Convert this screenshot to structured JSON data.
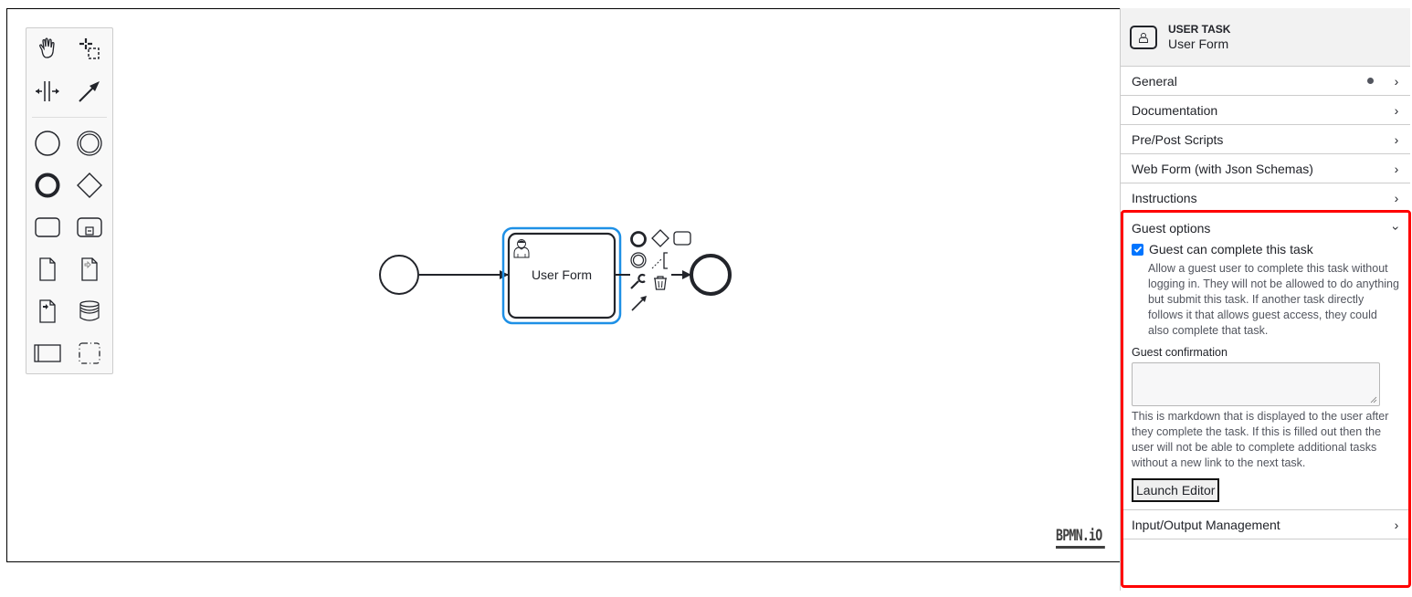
{
  "palette": {
    "tools": [
      {
        "name": "hand-tool",
        "icon": "hand-icon"
      },
      {
        "name": "lasso-tool",
        "icon": "lasso-icon"
      },
      {
        "name": "space-tool",
        "icon": "space-icon"
      },
      {
        "name": "global-connect-tool",
        "icon": "connect-arrow-icon"
      },
      {
        "name": "create-start-event",
        "icon": "start-event-icon"
      },
      {
        "name": "create-intermediate-event",
        "icon": "intermediate-event-icon"
      },
      {
        "name": "create-end-event",
        "icon": "end-event-icon"
      },
      {
        "name": "create-gateway",
        "icon": "gateway-icon"
      },
      {
        "name": "create-task",
        "icon": "task-icon"
      },
      {
        "name": "create-subprocess",
        "icon": "subprocess-icon"
      },
      {
        "name": "create-data-object",
        "icon": "data-object-icon"
      },
      {
        "name": "create-data-input",
        "icon": "data-input-icon"
      },
      {
        "name": "create-data-output",
        "icon": "data-output-icon"
      },
      {
        "name": "create-data-store",
        "icon": "data-store-icon"
      },
      {
        "name": "create-pool",
        "icon": "pool-icon"
      },
      {
        "name": "create-group",
        "icon": "group-icon"
      }
    ]
  },
  "diagram": {
    "task_label": "User Form",
    "selected_color": "#1e90e6"
  },
  "watermark": "BPMN.iO",
  "panel": {
    "element_type": "USER TASK",
    "element_name": "User Form",
    "groups": [
      {
        "label": "General",
        "has_dot": true
      },
      {
        "label": "Documentation"
      },
      {
        "label": "Pre/Post Scripts"
      },
      {
        "label": "Web Form (with Json Schemas)"
      },
      {
        "label": "Instructions"
      }
    ],
    "guest": {
      "label": "Guest options",
      "checkbox_label": "Guest can complete this task",
      "checked": true,
      "checkbox_desc": "Allow a guest user to complete this task without logging in. They will not be allowed to do anything but submit this task. If another task directly follows it that allows guest access, they could also complete that task.",
      "confirmation_label": "Guest confirmation",
      "confirmation_value": "",
      "confirmation_desc": "This is markdown that is displayed to the user after they complete the task. If this is filled out then the user will not be able to complete additional tasks without a new link to the next task.",
      "launch_button": "Launch Editor"
    },
    "io_group": {
      "label": "Input/Output Management"
    },
    "highlight_color": "#ff0000"
  }
}
